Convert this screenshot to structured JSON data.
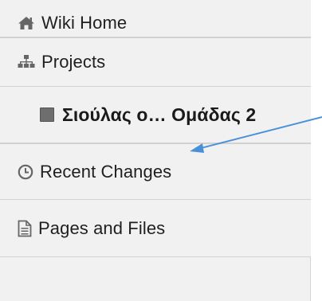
{
  "nav": {
    "items": [
      {
        "label": "Wiki Home",
        "icon": "home-icon"
      },
      {
        "label": "Projects",
        "icon": "sitemap-icon"
      },
      {
        "label": "Σιούλας ο… Ομάδας 2",
        "icon": "project-square-icon"
      },
      {
        "label": "Recent Changes",
        "icon": "clock-icon"
      },
      {
        "label": "Pages and Files",
        "icon": "document-icon"
      }
    ]
  },
  "colors": {
    "sidebar_bg": "#f1f1f1",
    "icon": "#666666",
    "text": "#1f1f1f",
    "annotation_arrow": "#4a90d9"
  }
}
